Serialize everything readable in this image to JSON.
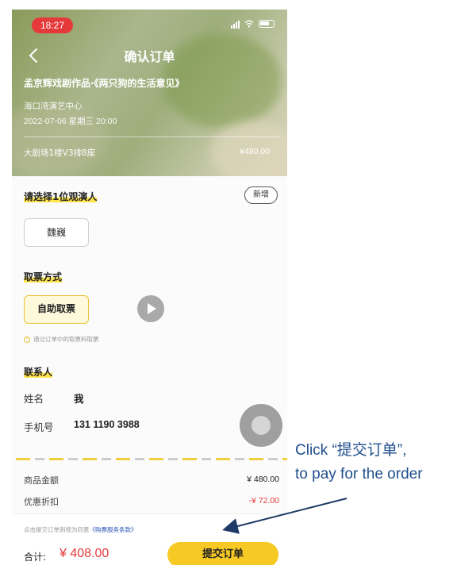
{
  "status_bar": {
    "time": "18:27"
  },
  "header": {
    "title": "确认订单",
    "show_title": "孟京辉戏剧作品·《两只狗的生活意见》",
    "venue": "海口湾演艺中心",
    "datetime": "2022-07-06 星期三 20:00",
    "seat": "大剧场1楼V3排8座",
    "seat_price": "¥480.00"
  },
  "viewer": {
    "title": "请选择1位观演人",
    "add_label": "新增",
    "selected": "魏巍"
  },
  "pickup": {
    "title": "取票方式",
    "option": "自助取票",
    "note": "通过订单中的取票码取票"
  },
  "contact": {
    "title": "联系人",
    "name_label": "姓名",
    "name_value": "我",
    "phone_label": "手机号",
    "phone_value": "131 1190 3988"
  },
  "summary": {
    "goods_label": "商品金额",
    "goods_value": "¥ 480.00",
    "discount_label": "优惠折扣",
    "discount_value": "-¥ 72.00"
  },
  "footer": {
    "agree_text": "点击提交订单则视为同意",
    "agree_link": "《购票服务条款》",
    "total_label": "合计:",
    "total_value": "¥ 408.00",
    "submit_label": "提交订单"
  },
  "annotation": {
    "line1": "Click “提交订单”,",
    "line2": "to pay for the order"
  },
  "colors": {
    "accent": "#f6c924",
    "price_red": "#e53a3a",
    "annotation_blue": "#1f4e8c"
  }
}
